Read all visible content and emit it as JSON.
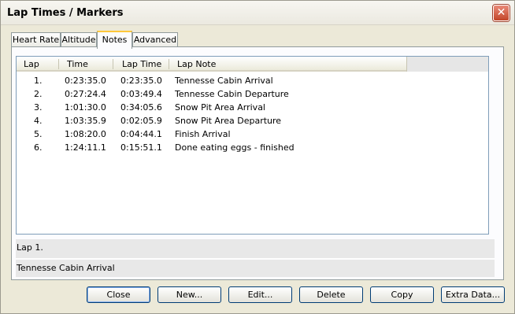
{
  "window": {
    "title": "Lap Times / Markers",
    "close_glyph": "✕"
  },
  "tabs": [
    {
      "label": "Heart Rate"
    },
    {
      "label": "Altitude"
    },
    {
      "label": "Notes"
    },
    {
      "label": "Advanced"
    }
  ],
  "active_tab": "Notes",
  "table": {
    "columns": [
      "Lap",
      "Time",
      "Lap Time",
      "Lap Note"
    ],
    "rows": [
      [
        "1.",
        "0:23:35.0",
        "0:23:35.0",
        "Tennesse Cabin Arrival"
      ],
      [
        "2.",
        "0:27:24.4",
        "0:03:49.4",
        "Tennesse Cabin Departure"
      ],
      [
        "3.",
        "1:01:30.0",
        "0:34:05.6",
        "Snow Pit Area Arrival"
      ],
      [
        "4.",
        "1:03:35.9",
        "0:02:05.9",
        "Snow Pit Area Departure"
      ],
      [
        "5.",
        "1:08:20.0",
        "0:04:44.1",
        "Finish Arrival"
      ],
      [
        "6.",
        "1:24:11.1",
        "0:15:51.1",
        "Done eating eggs - finished"
      ]
    ]
  },
  "status": {
    "line1": "Lap 1.",
    "line2": "Tennesse Cabin Arrival"
  },
  "buttons": {
    "close": "Close",
    "new": "New...",
    "edit": "Edit...",
    "delete": "Delete",
    "copy": "Copy",
    "extra_data": "Extra Data..."
  },
  "colors": {
    "tab_highlight": "#ffc83c",
    "close_button": "#c24529"
  }
}
